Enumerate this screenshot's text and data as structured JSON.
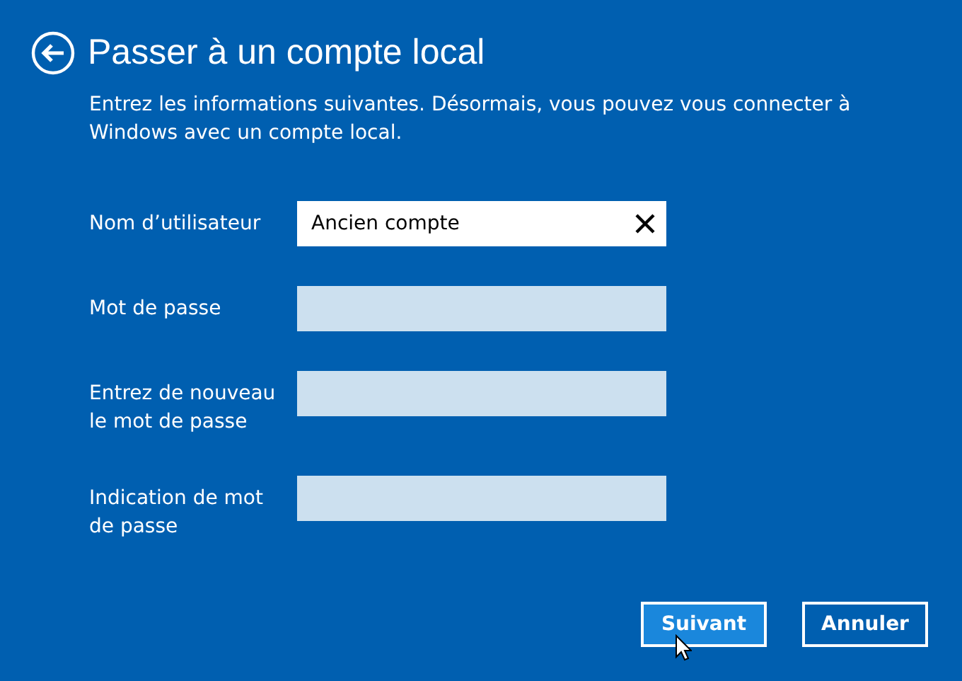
{
  "title": "Passer à un compte local",
  "description": "Entrez les informations suivantes. Désormais, vous pouvez vous connecter à Windows avec un compte local.",
  "fields": [
    {
      "label": "Nom d’utilisateur",
      "value": "Ancien compte",
      "focused": true
    },
    {
      "label": "Mot de passe",
      "focused": false
    },
    {
      "label": "Entrez de nouveau le mot de passe",
      "focused": false
    },
    {
      "label": "Indication de mot de passe",
      "focused": false
    }
  ],
  "buttons": [
    {
      "label": "Suivant",
      "hovered": true
    },
    {
      "label": "Annuler",
      "hovered": false
    }
  ]
}
